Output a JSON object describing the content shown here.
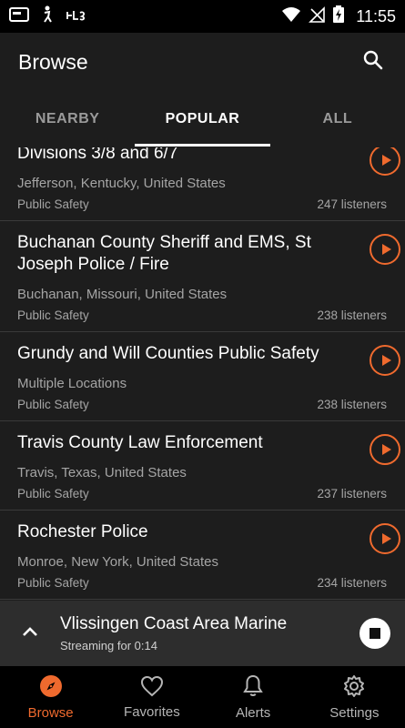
{
  "status_bar": {
    "time": "11:55"
  },
  "app_bar": {
    "title": "Browse"
  },
  "tabs": [
    {
      "label": "NEARBY",
      "active": false
    },
    {
      "label": "POPULAR",
      "active": true
    },
    {
      "label": "ALL",
      "active": false
    }
  ],
  "list": [
    {
      "title": "Divisions 3/8 and 6/7",
      "location": "Jefferson, Kentucky, United States",
      "category": "Public Safety",
      "listeners": "247 listeners"
    },
    {
      "title": "Buchanan County Sheriff and EMS, St Joseph Police / Fire",
      "location": "Buchanan, Missouri, United States",
      "category": "Public Safety",
      "listeners": "238 listeners"
    },
    {
      "title": "Grundy and Will Counties Public Safety",
      "location": "Multiple Locations",
      "category": "Public Safety",
      "listeners": "238 listeners"
    },
    {
      "title": "Travis County Law Enforcement",
      "location": "Travis, Texas, United States",
      "category": "Public Safety",
      "listeners": "237 listeners"
    },
    {
      "title": "Rochester Police",
      "location": "Monroe, New York, United States",
      "category": "Public Safety",
      "listeners": "234 listeners"
    }
  ],
  "now_playing": {
    "title": "Vlissingen Coast Area Marine",
    "subtitle": "Streaming for 0:14"
  },
  "bottom_nav": [
    {
      "label": "Browse",
      "icon": "compass-icon",
      "active": true
    },
    {
      "label": "Favorites",
      "icon": "heart-icon",
      "active": false
    },
    {
      "label": "Alerts",
      "icon": "bell-icon",
      "active": false
    },
    {
      "label": "Settings",
      "icon": "gear-icon",
      "active": false
    }
  ],
  "colors": {
    "accent": "#ef6a2e",
    "background": "#1d1d1d",
    "player": "#2d2d2d"
  }
}
